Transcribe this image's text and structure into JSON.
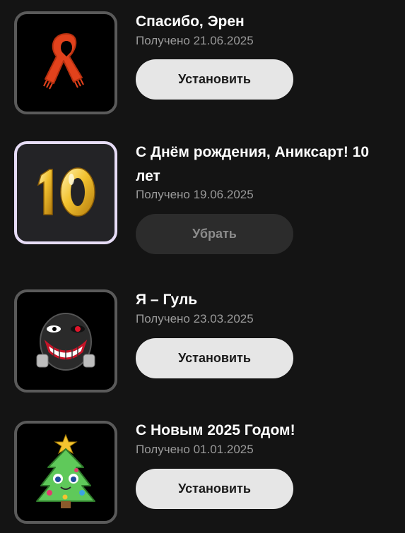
{
  "items": [
    {
      "title": "Спасибо, Эрен",
      "received": "Получено 21.06.2025",
      "button": "Установить",
      "icon": "red-scarf-icon"
    },
    {
      "title": "С Днём рождения, Аниксарт! 10 лет",
      "received": "Получено 19.06.2025",
      "button": "Убрать",
      "icon": "golden-balloon-10-icon"
    },
    {
      "title": "Я – Гуль",
      "received": "Получено 23.03.2025",
      "button": "Установить",
      "icon": "ghoul-mask-icon"
    },
    {
      "title": "С Новым 2025 Годом!",
      "received": "Получено 01.01.2025",
      "button": "Установить",
      "icon": "christmas-tree-icon"
    }
  ],
  "colors": {
    "background": "#141414",
    "button_primary": "#e6e6e6",
    "button_secondary": "#2c2c2c",
    "active_border": "#e6dcf6",
    "inactive_border": "#5a5a5a"
  }
}
